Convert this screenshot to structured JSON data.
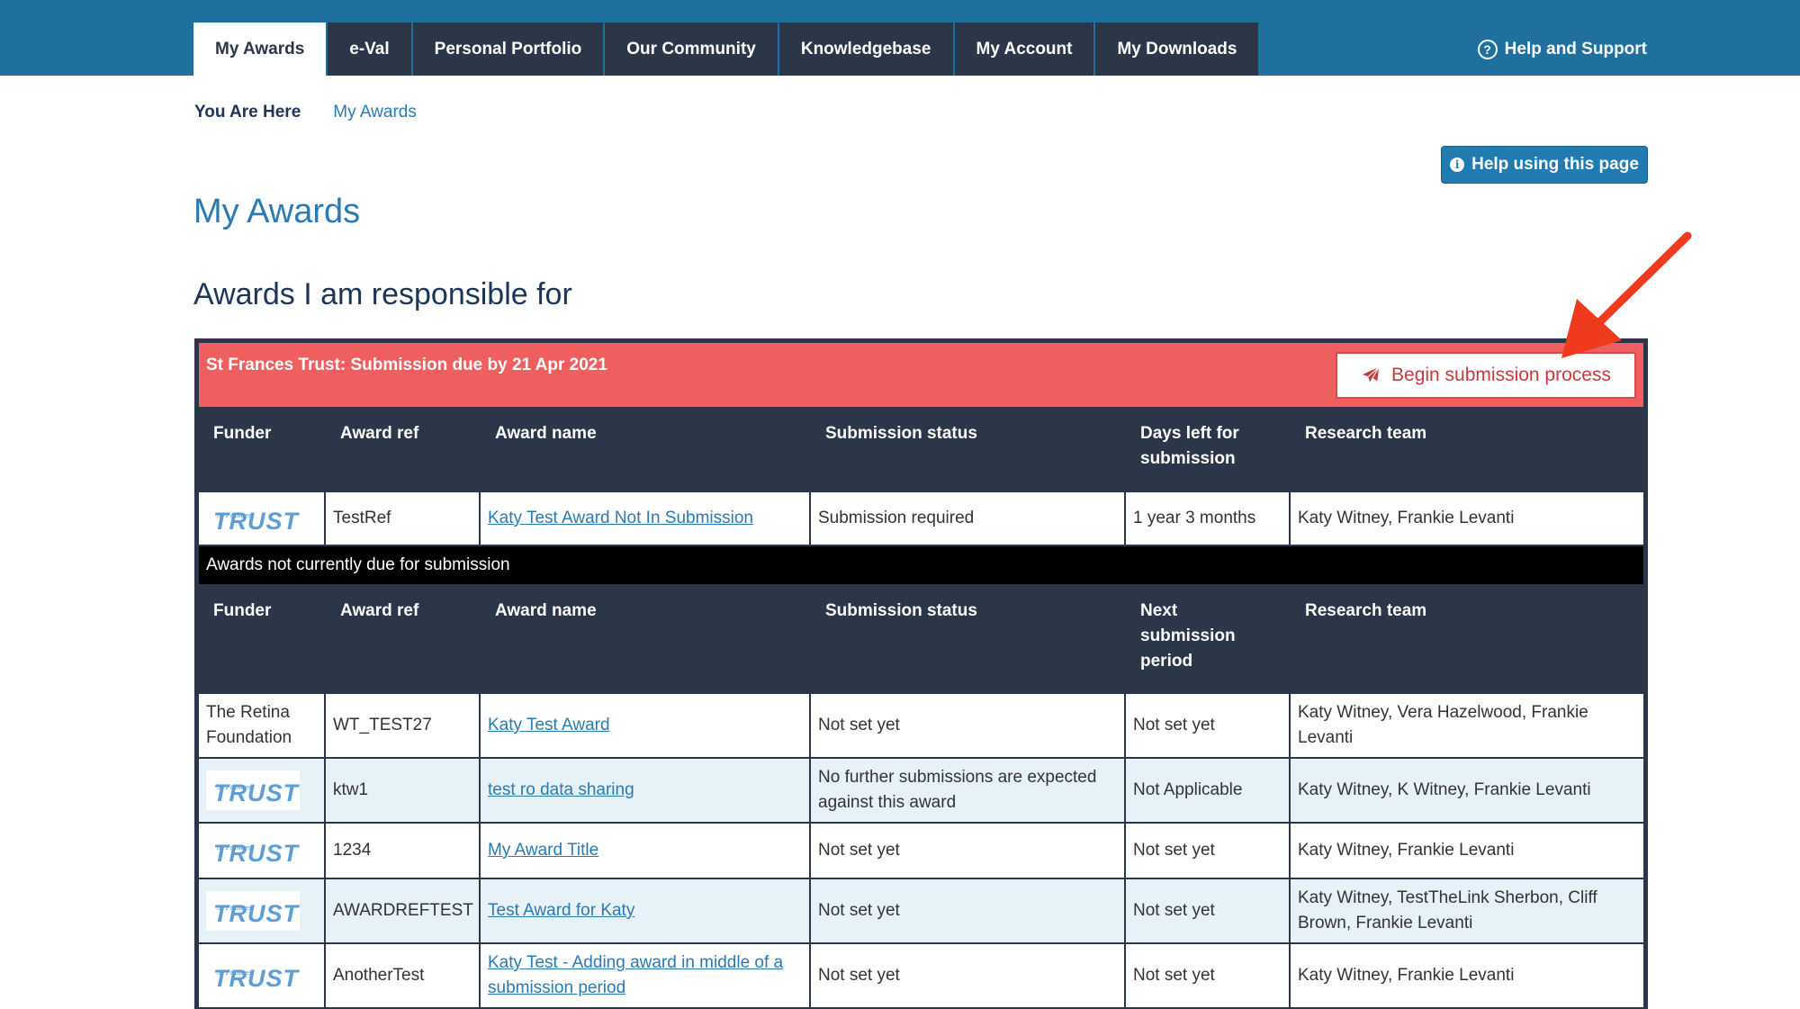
{
  "nav": {
    "tabs": [
      {
        "label": "My Awards",
        "active": true
      },
      {
        "label": "e-Val"
      },
      {
        "label": "Personal Portfolio"
      },
      {
        "label": "Our Community"
      },
      {
        "label": "Knowledgebase"
      },
      {
        "label": "My Account"
      },
      {
        "label": "My Downloads"
      }
    ],
    "help_support": "Help and Support"
  },
  "breadcrumb": {
    "label": "You Are Here",
    "current": "My Awards"
  },
  "help_page_button": "Help using this page",
  "page_title": "My Awards",
  "section_title": "Awards I am responsible for",
  "due_group": {
    "title": "St Frances Trust: Submission due by 21 Apr 2021",
    "button": "Begin submission process",
    "headers": [
      "Funder",
      "Award ref",
      "Award name",
      "Submission status",
      "Days left for submission",
      "Research team"
    ],
    "rows": [
      {
        "funder": "TRUST",
        "ref": "TestRef",
        "name": "Katy Test Award Not In Submission",
        "status": "Submission required",
        "days": "1 year 3 months",
        "team": "Katy Witney, Frankie Levanti"
      }
    ]
  },
  "not_due_group": {
    "title": "Awards not currently due for submission",
    "headers": [
      "Funder",
      "Award ref",
      "Award name",
      "Submission status",
      "Next submission period",
      "Research team"
    ],
    "rows": [
      {
        "funder": "The Retina Foundation",
        "ref": "WT_TEST27",
        "name": "Katy Test Award",
        "status": "Not set yet",
        "period": "Not set yet",
        "team": "Katy Witney, Vera Hazelwood, Frankie Levanti"
      },
      {
        "funder": "TRUST",
        "ref": "ktw1",
        "name": "test ro data sharing",
        "status": "No further submissions are expected against this award",
        "period": "Not Applicable",
        "team": "Katy Witney, K Witney, Frankie Levanti"
      },
      {
        "funder": "TRUST",
        "ref": "1234",
        "name": "My Award Title",
        "status": "Not set yet",
        "period": "Not set yet",
        "team": "Katy Witney, Frankie Levanti"
      },
      {
        "funder": "TRUST",
        "ref": "AWARDREFTEST",
        "name": "Test Award for Katy",
        "status": "Not set yet",
        "period": "Not set yet",
        "team": "Katy Witney, TestTheLink Sherbon, Cliff Brown, Frankie Levanti"
      },
      {
        "funder": "TRUST",
        "ref": "AnotherTest",
        "name": "Katy Test - Adding award in middle of a submission period",
        "status": "Not set yet",
        "period": "Not set yet",
        "team": "Katy Witney, Frankie Levanti"
      }
    ]
  },
  "trust_logo_small": "St Frances",
  "colors": {
    "nav_bg": "#1f6f9f",
    "tab_bg": "#2b3648",
    "due_bg": "#ef5f5f",
    "link": "#2a7ab3",
    "alt_row": "#e7f1f8",
    "arrow": "#f03a1e"
  },
  "icons": [
    "help-circle-icon",
    "info-circle-icon",
    "paper-plane-icon",
    "annotation-arrow"
  ]
}
